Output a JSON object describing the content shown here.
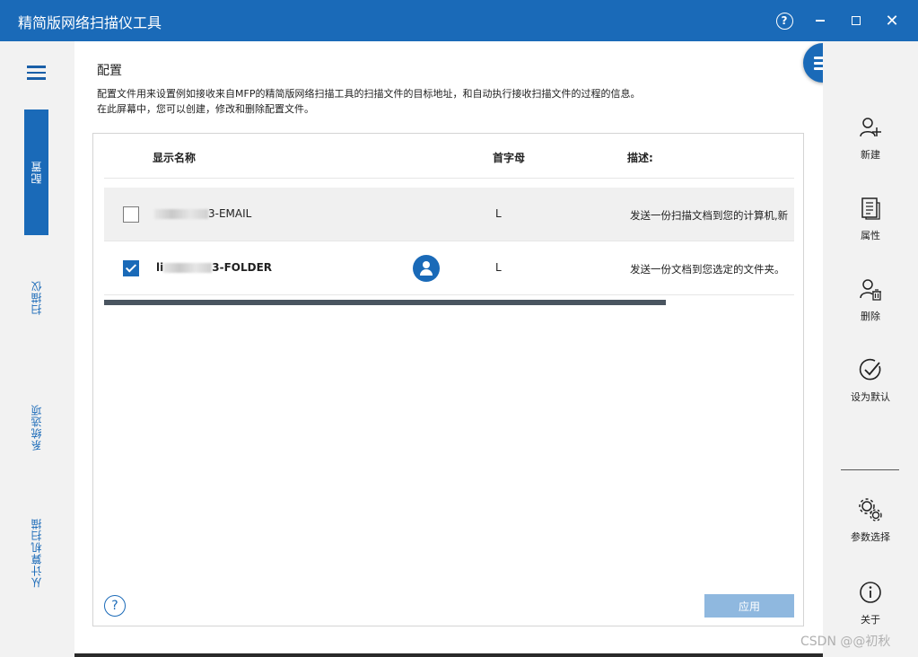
{
  "window": {
    "title": "精简版网络扫描仪工具",
    "help_glyph": "?",
    "close_glyph": "✕"
  },
  "nav": {
    "items": [
      {
        "label": "配置",
        "active": true
      },
      {
        "label": "扫描仪",
        "active": false
      },
      {
        "label": "系统选项",
        "active": false
      },
      {
        "label": "从计算机扫描",
        "active": false
      }
    ]
  },
  "page": {
    "title": "配置",
    "description_line1": "配置文件用来设置例如接收来自MFP的精简版网络扫描工具的扫描文件的目标地址，和自动执行接收扫描文件的过程的信息。",
    "description_line2": "在此屏幕中，您可以创建，修改和删除配置文件。"
  },
  "table": {
    "columns": [
      "显示名称",
      "首字母",
      "描述:"
    ],
    "rows": [
      {
        "checked": false,
        "name_prefix": "",
        "name_suffix": "3-EMAIL",
        "initial": "L",
        "description": "发送一份扫描文档到您的计算机,新",
        "is_default": false
      },
      {
        "checked": true,
        "name_prefix": "li",
        "name_suffix": "3-FOLDER",
        "initial": "L",
        "description": "发送一份文档到您选定的文件夹。",
        "is_default": true
      }
    ]
  },
  "footer": {
    "help_glyph": "?",
    "apply_label": "应用"
  },
  "actions": [
    {
      "label": "新建",
      "icon": "add-user-icon"
    },
    {
      "label": "属性",
      "icon": "properties-icon"
    },
    {
      "label": "删除",
      "icon": "delete-user-icon"
    },
    {
      "label": "设为默认",
      "icon": "check-circle-icon"
    },
    {
      "label": "参数选择",
      "icon": "gears-icon"
    },
    {
      "label": "关于",
      "icon": "info-icon"
    }
  ],
  "colors": {
    "accent": "#1a6ab8",
    "apply_disabled": "#8fb8df"
  },
  "watermark": "CSDN @@初秋"
}
